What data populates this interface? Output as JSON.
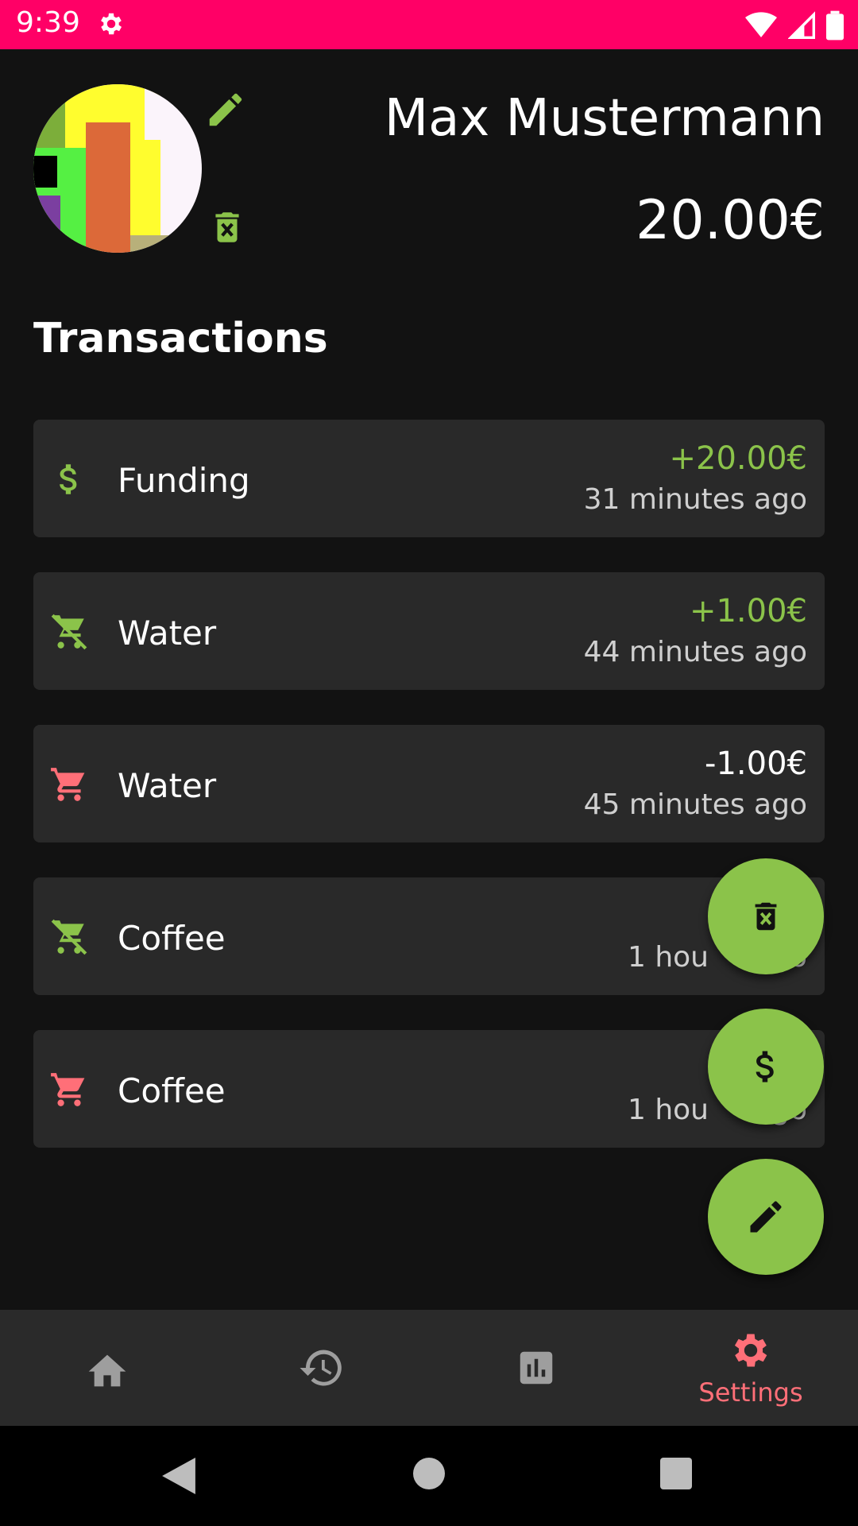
{
  "status_bar": {
    "time": "9:39",
    "icons": [
      "settings-icon",
      "wifi-icon",
      "signal-icon",
      "battery-icon"
    ],
    "background": "#ff0066"
  },
  "profile": {
    "name": "Max Mustermann",
    "balance": "20.00€",
    "actions": [
      "edit-icon",
      "delete-icon"
    ]
  },
  "transactions": {
    "title": "Transactions",
    "items": [
      {
        "icon": "dollar-icon",
        "label": "Funding",
        "amount": "+20.00€",
        "time": "31 minutes ago",
        "amount_color": "#8bc34a"
      },
      {
        "icon": "remove-shopping-cart-icon",
        "label": "Water",
        "amount": "+1.00€",
        "time": "44 minutes ago",
        "amount_color": "#8bc34a"
      },
      {
        "icon": "shopping-cart-icon",
        "label": "Water",
        "amount": "-1.00€",
        "time": "45 minutes ago",
        "amount_color": "#ffffff"
      },
      {
        "icon": "remove-shopping-cart-icon",
        "label": "Coffee",
        "amount": "+",
        "time": "1 hou",
        "time_tail": "go",
        "amount_color": "#8bc34a"
      },
      {
        "icon": "shopping-cart-icon",
        "label": "Coffee",
        "amount": "",
        "time": "1 hou",
        "time_tail": "go",
        "amount_color": "#ffffff"
      }
    ]
  },
  "fabs": [
    "delete-icon",
    "dollar-icon",
    "edit-icon"
  ],
  "bottom_nav": {
    "items": [
      {
        "icon": "home-icon",
        "label": ""
      },
      {
        "icon": "history-icon",
        "label": ""
      },
      {
        "icon": "bar-chart-icon",
        "label": ""
      },
      {
        "icon": "settings-icon",
        "label": "Settings",
        "active": true
      }
    ],
    "active_color": "#ff6f78",
    "inactive_color": "#9e9e9e"
  },
  "colors": {
    "accent_green": "#8bc34a",
    "cart_red": "#ff6f78",
    "card_bg": "#292929",
    "background": "#121212"
  }
}
